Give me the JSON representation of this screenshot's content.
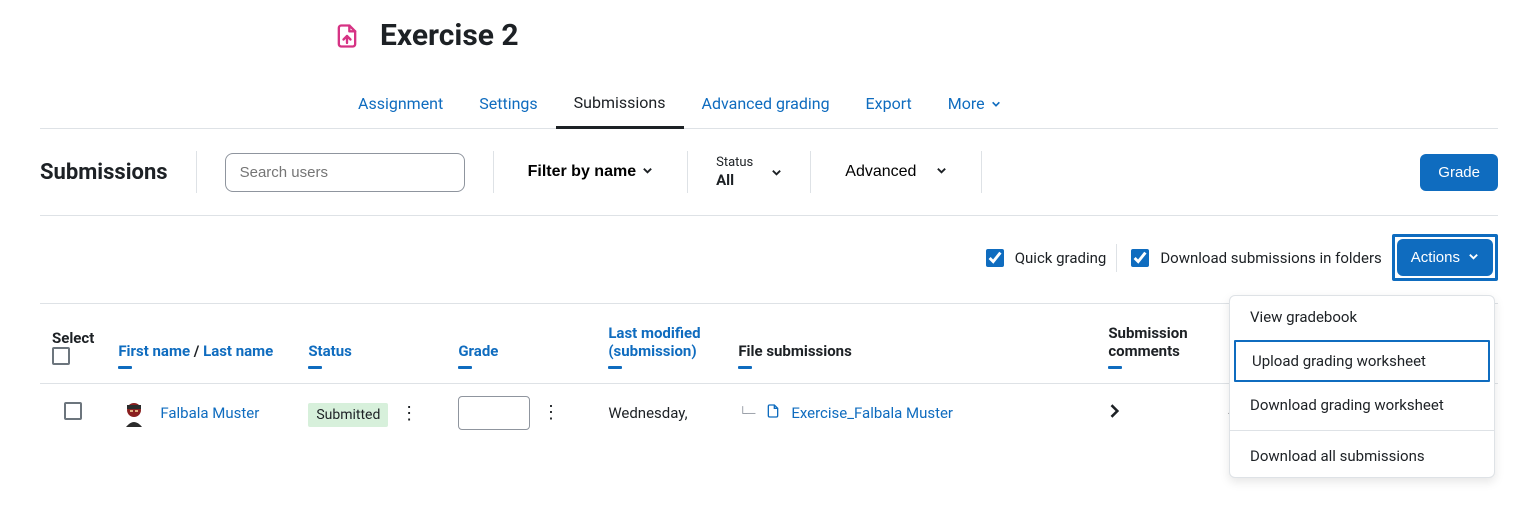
{
  "header": {
    "title": "Exercise 2"
  },
  "tabs": {
    "assignment": "Assignment",
    "settings": "Settings",
    "submissions": "Submissions",
    "advanced_grading": "Advanced grading",
    "export": "Export",
    "more": "More"
  },
  "toolbar": {
    "section_title": "Submissions",
    "search_placeholder": "Search users",
    "filter_label": "Filter by name",
    "status_label": "Status",
    "status_value": "All",
    "advanced_label": "Advanced",
    "grade_button": "Grade"
  },
  "options": {
    "quick_grading": "Quick grading",
    "download_folders": "Download submissions in folders",
    "actions_button": "Actions",
    "menu": {
      "view_gradebook": "View gradebook",
      "upload_worksheet": "Upload grading worksheet",
      "download_worksheet": "Download grading worksheet",
      "download_all": "Download all submissions"
    }
  },
  "table": {
    "headers": {
      "select": "Select",
      "first_name": "First name",
      "name_sep": " / ",
      "last_name": "Last name",
      "status": "Status",
      "grade": "Grade",
      "last_modified": "Last modified (submission)",
      "file_submissions": "File submissions",
      "submission_comments": "Submission comments"
    },
    "rows": [
      {
        "name": "Falbala Muster",
        "status": "Submitted",
        "last_modified": "Wednesday,",
        "file_name": "Exercise_Falbala Muster",
        "comments": "-"
      }
    ]
  }
}
